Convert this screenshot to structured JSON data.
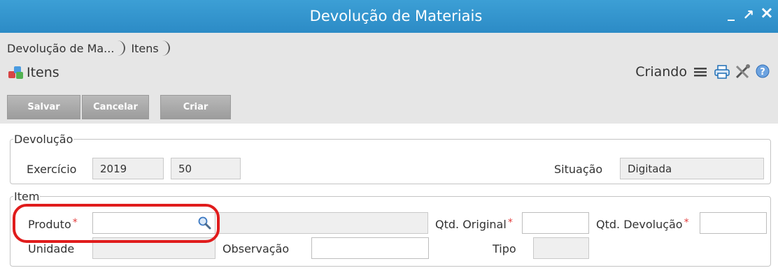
{
  "window": {
    "title": "Devolução de Materiais",
    "minimize": "_",
    "maximize": "↗",
    "close": "×"
  },
  "breadcrumb": [
    {
      "label": "Devolução de Ma..."
    },
    {
      "label": "Itens"
    }
  ],
  "header": {
    "title": "Itens",
    "mode": "Criando"
  },
  "toolbar": {
    "save_label": "Salvar",
    "cancel_label": "Cancelar",
    "create_label": "Criar"
  },
  "devolucao": {
    "legend": "Devolução",
    "exercicio_label": "Exercício",
    "exercicio_value": "2019",
    "numero_value": "50",
    "situacao_label": "Situação",
    "situacao_value": "Digitada"
  },
  "item": {
    "legend": "Item",
    "produto_label": "Produto",
    "produto_value": "",
    "qtd_original_label": "Qtd. Original",
    "qtd_devolucao_label": "Qtd. Devolução",
    "unidade_label": "Unidade",
    "observacao_label": "Observação",
    "tipo_label": "Tipo"
  },
  "required_marker": "*",
  "colors": {
    "titlebar": "#2f91cb",
    "panel": "#e6e6e6",
    "button": "#a8a8a8",
    "highlight": "#e01c1c"
  }
}
